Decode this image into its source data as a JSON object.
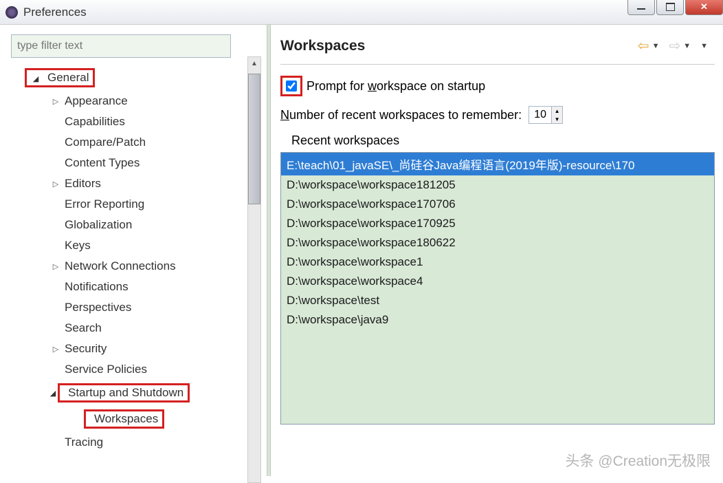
{
  "window": {
    "title": "Preferences"
  },
  "sidebar": {
    "filter_placeholder": "type filter text",
    "items": [
      {
        "label": "General",
        "level": 0,
        "arrow": "expanded",
        "highlight": true
      },
      {
        "label": "Appearance",
        "level": 1,
        "arrow": "collapsed"
      },
      {
        "label": "Capabilities",
        "level": 1,
        "arrow": ""
      },
      {
        "label": "Compare/Patch",
        "level": 1,
        "arrow": ""
      },
      {
        "label": "Content Types",
        "level": 1,
        "arrow": ""
      },
      {
        "label": "Editors",
        "level": 1,
        "arrow": "collapsed"
      },
      {
        "label": "Error Reporting",
        "level": 1,
        "arrow": ""
      },
      {
        "label": "Globalization",
        "level": 1,
        "arrow": ""
      },
      {
        "label": "Keys",
        "level": 1,
        "arrow": ""
      },
      {
        "label": "Network Connections",
        "level": 1,
        "arrow": "collapsed"
      },
      {
        "label": "Notifications",
        "level": 1,
        "arrow": ""
      },
      {
        "label": "Perspectives",
        "level": 1,
        "arrow": ""
      },
      {
        "label": "Search",
        "level": 1,
        "arrow": ""
      },
      {
        "label": "Security",
        "level": 1,
        "arrow": "collapsed"
      },
      {
        "label": "Service Policies",
        "level": 1,
        "arrow": ""
      },
      {
        "label": "Startup and Shutdown",
        "level": 1,
        "arrow": "expanded",
        "highlight": true
      },
      {
        "label": "Workspaces",
        "level": 2,
        "arrow": "",
        "highlight": true
      },
      {
        "label": "Tracing",
        "level": 1,
        "arrow": ""
      }
    ]
  },
  "main": {
    "title": "Workspaces",
    "prompt_label_pre": "Prompt for ",
    "prompt_label_mnemonic": "w",
    "prompt_label_post": "orkspace on startup",
    "number_label_mnemonic": "N",
    "number_label_post": "umber of recent workspaces to remember:",
    "number_value": "10",
    "recent_label": "Recent workspaces",
    "recent_list": [
      {
        "text": "E:\\teach\\01_javaSE\\_尚硅谷Java编程语言(2019年版)-resource\\170",
        "selected": true
      },
      {
        "text": "D:\\workspace\\workspace181205",
        "selected": false
      },
      {
        "text": "D:\\workspace\\workspace170706",
        "selected": false
      },
      {
        "text": "D:\\workspace\\workspace170925",
        "selected": false
      },
      {
        "text": "D:\\workspace\\workspace180622",
        "selected": false
      },
      {
        "text": "D:\\workspace\\workspace1",
        "selected": false
      },
      {
        "text": "D:\\workspace\\workspace4",
        "selected": false
      },
      {
        "text": "D:\\workspace\\test",
        "selected": false
      },
      {
        "text": "D:\\workspace\\java9",
        "selected": false
      }
    ]
  },
  "watermark": "头条 @Creation无极限"
}
